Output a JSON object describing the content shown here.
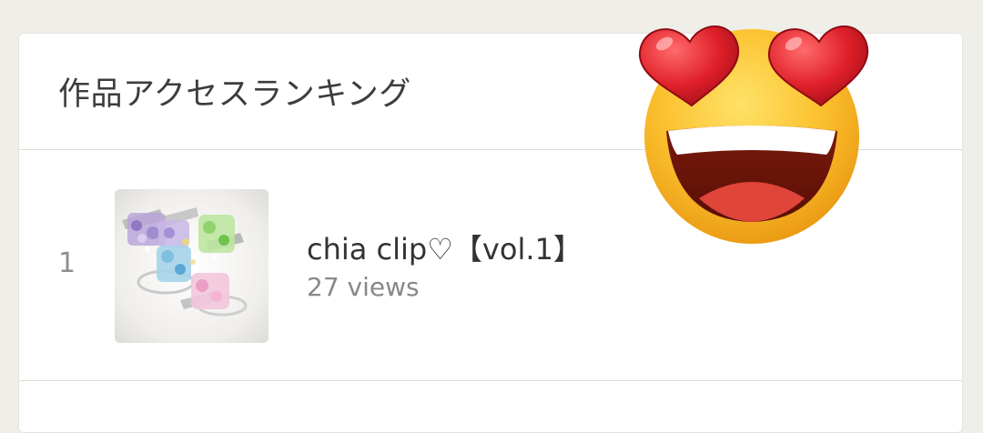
{
  "ranking": {
    "title": "作品アクセスランキング",
    "items": [
      {
        "rank": "1",
        "title": "chia clip♡【vol.1】",
        "views": "27 views",
        "thumbnail_icon": "hair-clip-photo"
      }
    ]
  },
  "overlay": {
    "emoji_icon": "heart-eyes-emoji"
  },
  "colors": {
    "background": "#efeee9",
    "card": "#ffffff",
    "divider": "#dddcd6",
    "title_text": "#3d3d3d",
    "muted_text": "#888888"
  }
}
